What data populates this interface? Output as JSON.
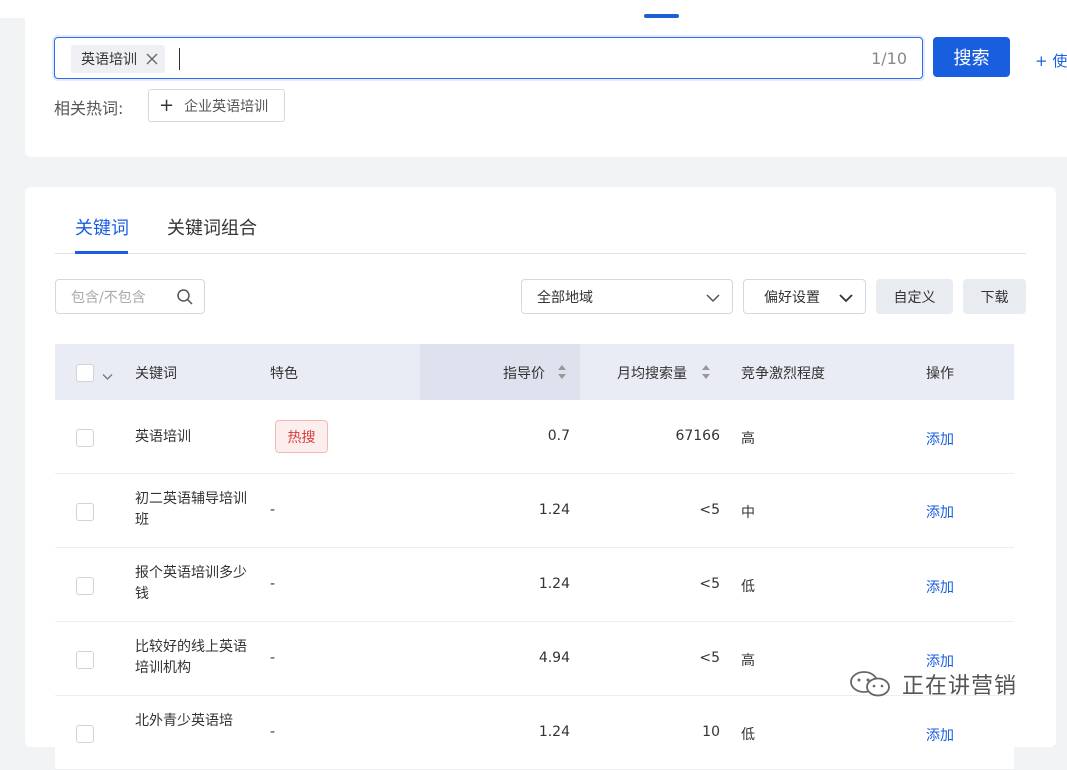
{
  "search": {
    "tag": "英语培训",
    "count": "1/10",
    "button": "搜索",
    "extra_link": "+ 使"
  },
  "related": {
    "label": "相关热词:",
    "chip": "企业英语培训"
  },
  "tabs": [
    {
      "label": "关键词",
      "active": true
    },
    {
      "label": "关键词组合",
      "active": false
    }
  ],
  "filters": {
    "placeholder": "包含/不包含",
    "region": "全部地域",
    "preference": "偏好设置",
    "custom": "自定义",
    "download": "下载"
  },
  "table": {
    "headers": {
      "keyword": "关键词",
      "feature": "特色",
      "price": "指导价",
      "volume": "月均搜索量",
      "competition": "竞争激烈程度",
      "action": "操作"
    },
    "rows": [
      {
        "keyword": "英语培训",
        "feature": "热搜",
        "price": "0.7",
        "volume": "67166",
        "competition": "高",
        "action": "添加"
      },
      {
        "keyword": "初二英语辅导培训班",
        "feature": "-",
        "price": "1.24",
        "volume": "<5",
        "competition": "中",
        "action": "添加"
      },
      {
        "keyword": "报个英语培训多少钱",
        "feature": "-",
        "price": "1.24",
        "volume": "<5",
        "competition": "低",
        "action": "添加"
      },
      {
        "keyword": "比较好的线上英语培训机构",
        "feature": "-",
        "price": "4.94",
        "volume": "<5",
        "competition": "高",
        "action": "添加"
      },
      {
        "keyword": "北外青少英语培",
        "feature": "-",
        "price": "1.24",
        "volume": "10",
        "competition": "低",
        "action": "添加"
      }
    ]
  },
  "watermark": "正在讲营销",
  "colors": {
    "accent": "#1a5ee0",
    "hot_badge_text": "#d64040",
    "hot_badge_bg": "#fdeeee",
    "header_bg": "#e9ecf4"
  }
}
